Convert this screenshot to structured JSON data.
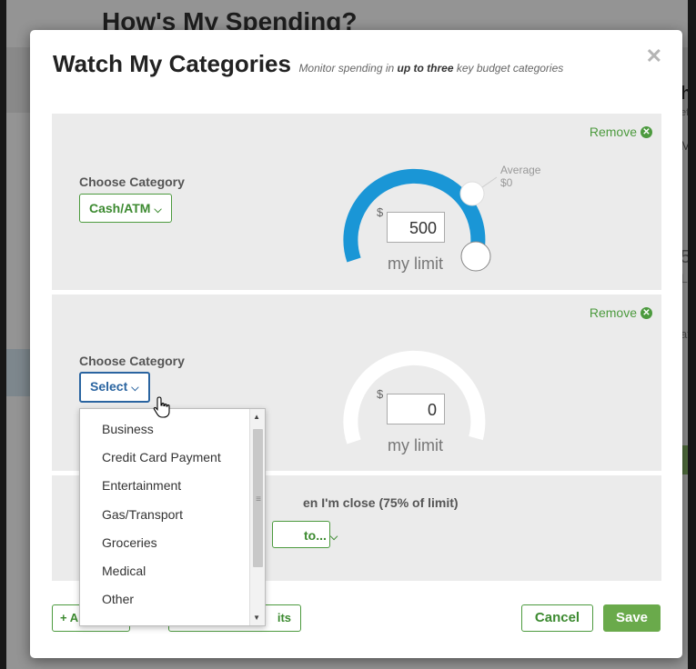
{
  "background": {
    "title": "How's My Spending?",
    "right_a": "h",
    "right_b": "eft",
    "right_c": "M",
    "right_d": "50",
    "right_e": "Li",
    "right_f": "at"
  },
  "modal": {
    "title": "Watch My Categories",
    "subtitle_pre": "Monitor spending in ",
    "subtitle_bold": "up to three",
    "subtitle_post": " key budget categories",
    "close_glyph": "✕"
  },
  "categories": [
    {
      "remove_label": "Remove",
      "choose_label": "Choose Category",
      "selected": "Cash/ATM",
      "currency": "$",
      "limit": "500",
      "limit_caption": "my limit",
      "average_label": "Average $0",
      "fill_color": "#1a96d6"
    },
    {
      "remove_label": "Remove",
      "choose_label": "Choose Category",
      "selected": "Select",
      "currency": "$",
      "limit": "0",
      "limit_caption": "my limit"
    }
  ],
  "alert": {
    "text_visible": "en I'm close (75% of limit)",
    "notify_button_visible": "to..."
  },
  "footer": {
    "add_label_visible": "+ A",
    "remove_limits_visible": "its",
    "cancel_label": "Cancel",
    "save_label": "Save"
  },
  "dropdown": {
    "options": [
      "Business",
      "Credit Card Payment",
      "Entertainment",
      "Gas/Transport",
      "Groceries",
      "Medical",
      "Other"
    ]
  },
  "colors": {
    "accent_green": "#4c9a3e",
    "save_green": "#6aaa4b",
    "gauge_blue": "#1a96d6",
    "select_blue": "#2a64a0"
  }
}
